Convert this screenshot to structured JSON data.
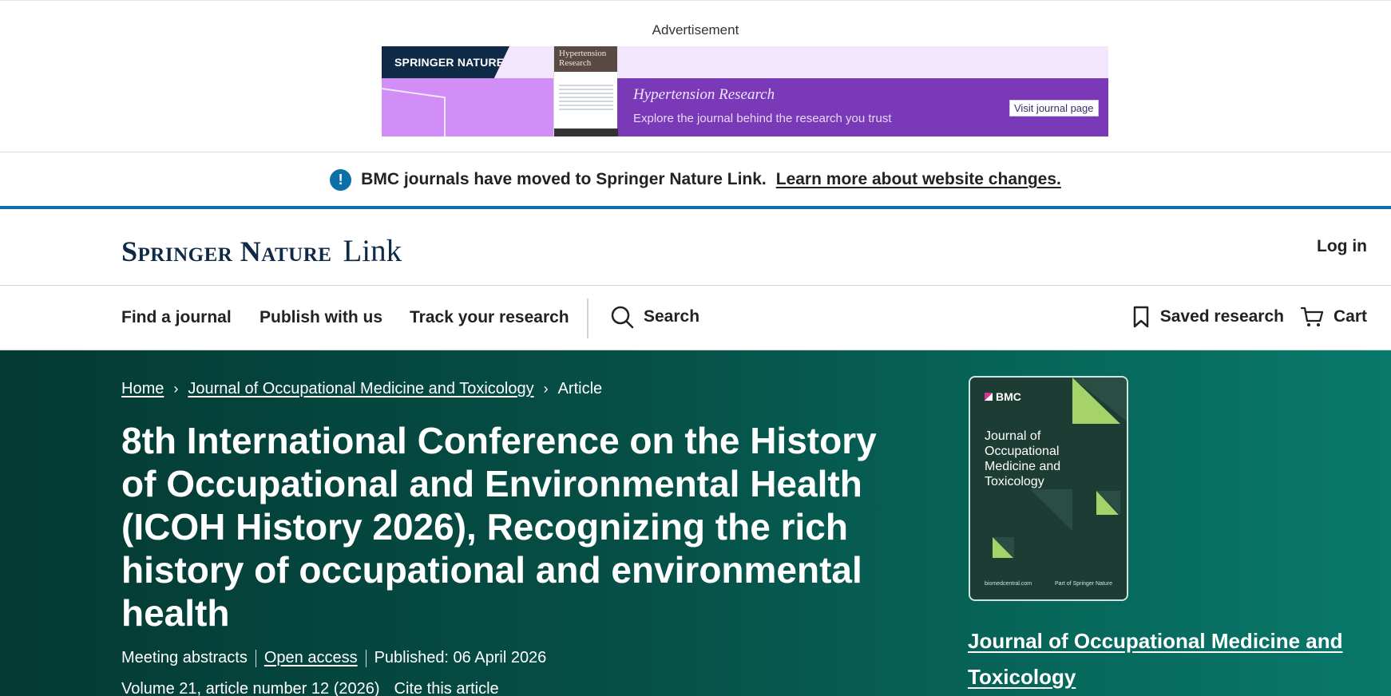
{
  "ad": {
    "label": "Advertisement",
    "brand": "SPRINGER NATURE",
    "cover_text": "Hypertension Research",
    "title": "Hypertension Research",
    "subtitle": "Explore the journal behind the research you trust",
    "button": "Visit journal page"
  },
  "notice": {
    "text": "BMC journals have moved to Springer Nature Link.",
    "link": "Learn more about website changes."
  },
  "header": {
    "brand_name": "Springer Nature",
    "brand_link": "Link",
    "login": "Log in"
  },
  "nav": {
    "find_journal": "Find a journal",
    "publish": "Publish with us",
    "track": "Track your research",
    "search": "Search",
    "saved": "Saved research",
    "cart": "Cart"
  },
  "breadcrumb": {
    "home": "Home",
    "journal": "Journal of Occupational Medicine and Toxicology",
    "current": "Article"
  },
  "article": {
    "title": "8th International Conference on the History of Occupational and Environmental Health (ICOH History 2026), Recognizing the rich history of occupational and environmental health",
    "type": "Meeting abstracts",
    "access": "Open access",
    "published": "Published: 06 April 2026",
    "volume": "Volume 21, article number 12 (2026)",
    "cite": "Cite this article"
  },
  "journal": {
    "cover_brand": "BMC",
    "cover_title": "Journal of Occupational Medicine and Toxicology",
    "cover_site": "biomedcentral.com",
    "cover_part": "Part of Springer Nature",
    "link": "Journal of Occupational Medicine and Toxicology"
  },
  "colors": {
    "brand_navy": "#0e2a47",
    "notice_blue": "#0b6fa8",
    "hero_dark": "#033a33",
    "hero_light": "#08796b"
  }
}
